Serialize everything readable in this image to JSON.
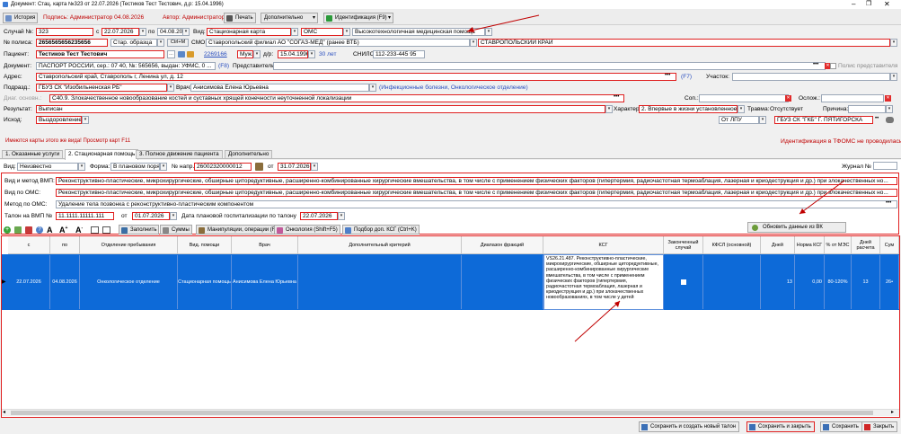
{
  "window": {
    "title": "Документ: Стац. карта №323 от 22.07.2026 (Тестиков Тест Тестович, д.р: 15.04.1996)"
  },
  "toolbar": {
    "history": "История",
    "signer": "Подпись: Администратор 04.08.2026",
    "author": "Автор: Администратор",
    "print": "Печать",
    "extra": "Дополнительно",
    "ident": "Идентификация (F9)"
  },
  "form": {
    "case_label": "Случай №:",
    "case_no": "323",
    "from_label": "с",
    "date_from": "22.07.2026",
    "to_label": "по",
    "date_to": "04.08.2026",
    "type_label": "Вид:",
    "type_value": "Стационарная карта",
    "fin_value": "ОМС",
    "aid_value": "Высокотехнологичная медицинская помощь",
    "policy_label": "№ полиса:",
    "policy_no": "2656565656235656",
    "policy_type": "Стар. образца",
    "ctrl": "Ctrl+M",
    "smo_label": "СМО:",
    "smo_value": "Ставропольский филиал АО \"СОГАЗ-МЕД\" (ранее ВТБ)",
    "region_value": "СТАВРОПОЛЬСКИЙ КРАЙ",
    "patient_label": "Пациент:",
    "patient_name": "Тестиков Тест Тестович",
    "patient_id": "2269166",
    "sex": "Муж.",
    "dob_label": "д/р:",
    "dob": "15.04.1996",
    "age": "30 лет",
    "snils_label": "СНИЛС:",
    "snils": "112-233-445 95",
    "doc_label": "Документ:",
    "doc_value": "ПАСПОРТ РОССИИ, сер.: 07 40, №: 565656, выдан: УФМС, 0 ...",
    "doc_key": "(F8)",
    "rep_label": "Представитель:",
    "rep_check": "Полис представителя",
    "address_label": "Адрес:",
    "address_value": "Ставропольский край, Ставрополь г, Ленина ул, д. 12",
    "addr_key": "(F7)",
    "district_label": "Участок:",
    "dept_label": "Подразд.:",
    "dept_value": "ГБУЗ СК \"Изобильненская РБ\"",
    "doctor_label": "Врач:",
    "doctor_value": "Анисимова Елена Юрьевна",
    "doctor_spec": "(Инфекционные болезни, Онкологическое отделение)",
    "diag_label": "Диаг. основн.:",
    "diag_value": "С40.9. Злокачественное новообразование костей и суставных хрящей конечности неуточненной локализации",
    "concom_label": "Соп.:",
    "compl_label": "Ослож.:",
    "result_label": "Результат:",
    "result_value": "Выписан",
    "char_label": "Характер:",
    "char_value": "2. Впервые в жизни установленное",
    "trauma_label": "Травма:",
    "trauma_value": "Отсутствует",
    "reason_label": "Причина:",
    "outcome_label": "Исход:",
    "outcome_value": "Выздоровление",
    "from_lpu": "От ЛПУ",
    "lpu_value": "ГБУЗ СК \"ГКБ\" Г. ПЯТИГОРСКА",
    "maps_note": "Имеются карты этого же вида! Просмотр карт F11",
    "ident_note": "Идентификация в ТФОМС не проводилась!"
  },
  "tabs": [
    "1. Оказанные услуги",
    "2. Стационарная помощь",
    "3. Полное движение пациента",
    "Дополнительно"
  ],
  "stac": {
    "vid_label": "Вид:",
    "vid_value": "Неизвестно",
    "form_label": "Форма:",
    "form_value": "В плановом поря",
    "napr_label": "№ напр.:",
    "napr_value": "26002320000012",
    "ot_label": "от",
    "ot_value": "31.07.2026",
    "journal_label": "Журнал №",
    "vmp_label": "Вид и метод ВМП:",
    "vmp_value": "Реконструктивно-пластические, микрохирургические, обширные циторедуктивные, расширенно-комбинированные хирургические вмешательства, в том числе с применением физических факторов (гипертермия, радиочастотная термоаблация, лазерная и криодеструкция и др.) при злокачественных но...",
    "oms_label": "Вид по ОМС:",
    "oms_value": "Реконструктивно-пластические, микрохирургические, обширные циторедуктивные, расширенно-комбинированные хирургические вмешательства, в том числе с применением физических факторов (гипертермия, радиочастотная термоаблация, лазерная и криодеструкция и др.) при злокачественных но...",
    "method_label": "Метод по ОМС:",
    "method_value": "Удаление тела позвонка с реконструктивно-пластическим компонентом",
    "talon_label": "Талон на ВМП №",
    "talon_value": "11.1111.11111.111",
    "talon_ot": "от",
    "talon_date": "01.07.2026",
    "plan_label": "Дата плановой госпитализации по талону",
    "plan_date": "22.07.2026",
    "update_btn": "Обновить данные из ВК"
  },
  "grid_toolbar": {
    "fill": "Заполнить",
    "sums": "Суммы",
    "manip": "Манипуляции, операции (F5)",
    "onco": "Онкология (Shift+F5)",
    "ksg_pick": "Подбор доп. КСГ (Ctrl+K)"
  },
  "grid": {
    "headers": [
      "с",
      "по",
      "Отделение пребывания",
      "Вид. помощи",
      "Врач",
      "Дополнительный критерий",
      "Диапазон фракций",
      "КСГ",
      "Законченный случай",
      "КФСЛ (основной)",
      "Дней",
      "Норма КСГ",
      "% от МЭС",
      "Дней расчета",
      "Сум"
    ],
    "row": {
      "from": "22.07.2026",
      "to": "04.08.2026",
      "dept": "Онкологическое отделение",
      "aid": "Стационарная помощь",
      "doctor": "Анисимова Елена Юрьевна",
      "ksg": "VS26.21.487. Реконструктивно-пластические, микрохирургические, обширные циторедуктивные, расширенно-комбинированные хирургические вмешательства, в том числе с применением физических факторов (гипертермия, радиочастотная термоаблация, лазерная и криодеструкция и др.) при злокачественных новообразованиях, в том числе у детей",
      "days": "13",
      "norm": "0,00",
      "mes": "80-120%",
      "calc_days": "13",
      "sum": "26•"
    }
  },
  "footer": {
    "save_new": "Сохранить и создать новый талон",
    "save_close": "Сохранить и закрыть",
    "save": "Сохранить",
    "close": "Закрыть"
  }
}
